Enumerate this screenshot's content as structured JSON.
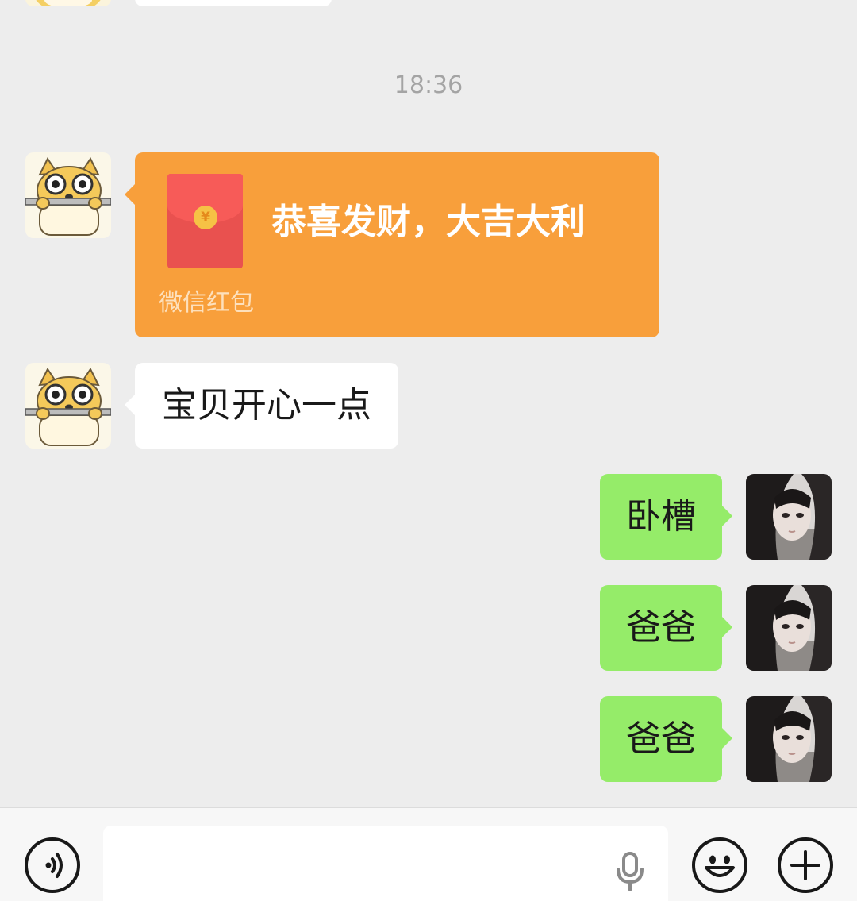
{
  "chat": {
    "timestamp": "18:36",
    "red_packet": {
      "title": "恭喜发财，大吉大利",
      "label": "微信红包",
      "coin_symbol": "¥",
      "color": "#f89f3b"
    },
    "incoming_text": "宝贝开心一点",
    "outgoing_messages": [
      {
        "text": "卧槽"
      },
      {
        "text": "爸爸"
      },
      {
        "text": "爸爸"
      }
    ]
  },
  "input_bar": {
    "voice_icon": "voice-mode-icon",
    "mic_icon": "microphone-icon",
    "emoji_icon": "emoji-smile-icon",
    "more_icon": "plus-icon"
  },
  "colors": {
    "background": "#ededed",
    "incoming_bubble": "#ffffff",
    "outgoing_bubble": "#95ec69"
  }
}
